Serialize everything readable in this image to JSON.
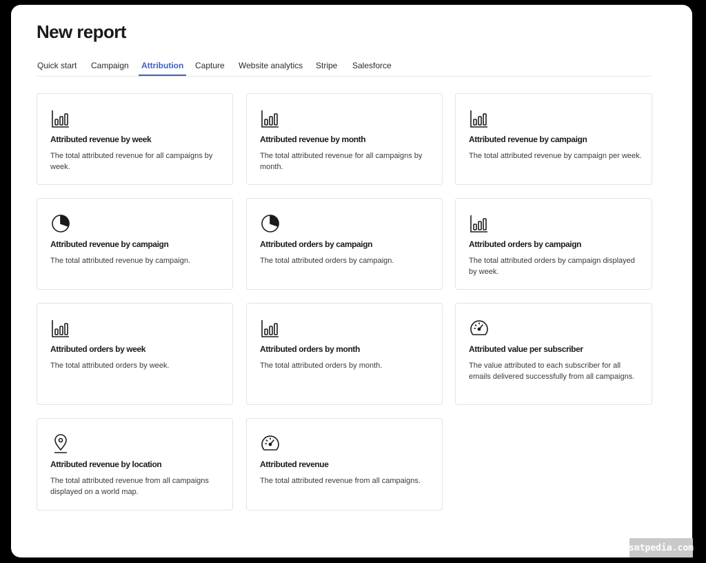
{
  "page": {
    "title": "New report"
  },
  "tabs": [
    {
      "label": "Quick start",
      "active": false
    },
    {
      "label": "Campaign",
      "active": false
    },
    {
      "label": "Attribution",
      "active": true
    },
    {
      "label": "Capture",
      "active": false
    },
    {
      "label": "Website analytics",
      "active": false
    },
    {
      "label": "Stripe",
      "active": false
    },
    {
      "label": "Salesforce",
      "active": false
    }
  ],
  "colors": {
    "accent": "#3d5fc1",
    "text": "#1b1b1b",
    "border": "#e3e3e3"
  },
  "cards": [
    {
      "icon": "bar-chart-icon",
      "title": "Attributed revenue by week",
      "description": "The total attributed revenue for all campaigns by week."
    },
    {
      "icon": "bar-chart-icon",
      "title": "Attributed revenue by month",
      "description": "The total attributed revenue for all campaigns by month."
    },
    {
      "icon": "bar-chart-icon",
      "title": "Attributed revenue by campaign",
      "description": "The total attributed revenue by campaign per week."
    },
    {
      "icon": "pie-chart-icon",
      "title": "Attributed revenue by campaign",
      "description": "The total attributed revenue by campaign."
    },
    {
      "icon": "pie-chart-icon",
      "title": "Attributed orders by campaign",
      "description": "The total attributed orders by campaign."
    },
    {
      "icon": "bar-chart-icon",
      "title": "Attributed orders by campaign",
      "description": "The total attributed orders by campaign displayed by week."
    },
    {
      "icon": "bar-chart-icon",
      "title": "Attributed orders by week",
      "description": "The total attributed orders by week."
    },
    {
      "icon": "bar-chart-icon",
      "title": "Attributed orders by month",
      "description": "The total attributed orders by month."
    },
    {
      "icon": "gauge-icon",
      "title": "Attributed value per subscriber",
      "description": "The value attributed to each subscriber for all emails delivered successfully from all campaigns."
    },
    {
      "icon": "location-pin-icon",
      "title": "Attributed revenue by location",
      "description": "The total attributed revenue from all campaigns displayed on a world map."
    },
    {
      "icon": "gauge-icon",
      "title": "Attributed revenue",
      "description": "The total attributed revenue from all campaigns."
    }
  ],
  "watermark": "smtpedia.com"
}
